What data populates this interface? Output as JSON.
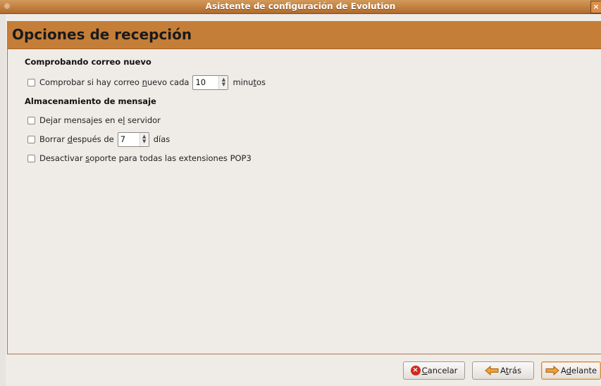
{
  "window": {
    "title": "Asistente de configuración de Evolution",
    "close_glyph": "×"
  },
  "page": {
    "title": "Opciones de recepción"
  },
  "sections": {
    "new_mail": {
      "title": "Comprobando correo nuevo",
      "check": {
        "label_pre": "Comprobar si hay correo ",
        "label_mnemonic": "n",
        "label_post": "uevo cada",
        "value": "10",
        "unit_pre": "minu",
        "unit_mnemonic": "t",
        "unit_post": "os",
        "checked": false
      }
    },
    "storage": {
      "title": "Almacenamiento de mensaje",
      "leave_on_server": {
        "label_pre": "Dejar mensajes en e",
        "label_mnemonic": "l",
        "label_post": " servidor",
        "checked": false
      },
      "delete_after": {
        "label_pre": "Borrar ",
        "label_mnemonic": "d",
        "label_post": "espués de",
        "value": "7",
        "unit": "días",
        "checked": false
      },
      "disable_pop3": {
        "label_pre": "Desactivar ",
        "label_mnemonic": "s",
        "label_post": "oporte para todas las extensiones POP3",
        "checked": false
      }
    }
  },
  "buttons": {
    "cancel": {
      "mnemonic": "C",
      "rest": "ancelar"
    },
    "back": {
      "pre": "A",
      "mnemonic": "t",
      "post": "rás"
    },
    "forward": {
      "pre": "A",
      "mnemonic": "d",
      "post": "elante"
    }
  },
  "colors": {
    "accent": "#c57e38",
    "titlebar": "#b8743a",
    "cancel_icon": "#d4271b",
    "arrow": "#f0a030"
  },
  "icons": {
    "window": "app-icon",
    "cancel": "cancel-icon",
    "back": "arrow-left-icon",
    "forward": "arrow-right-icon"
  }
}
